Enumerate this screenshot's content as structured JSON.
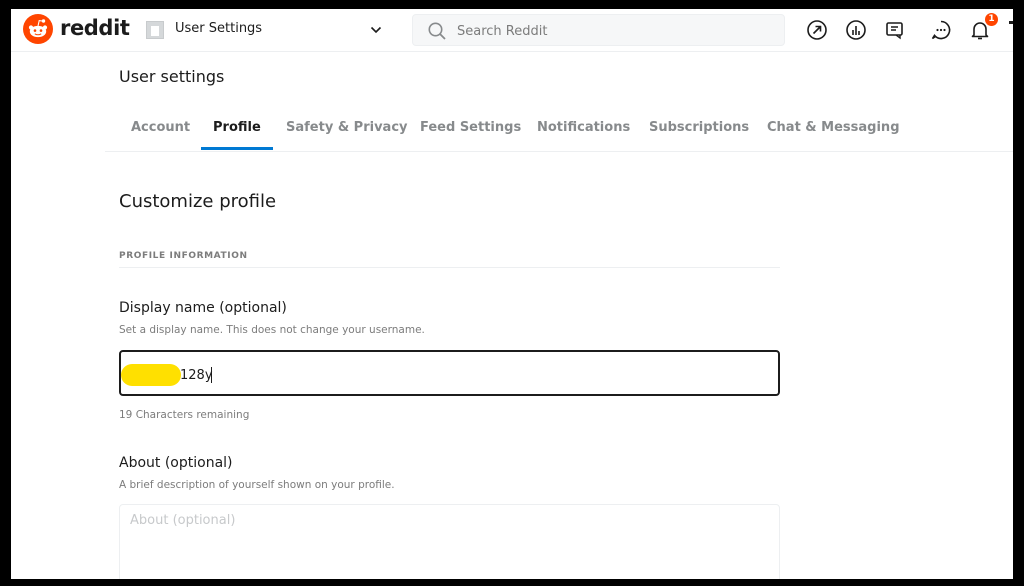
{
  "header": {
    "brand": "reddit",
    "community_label": "User Settings",
    "search_placeholder": "Search Reddit",
    "notification_count": "1",
    "colors": {
      "brand": "#ff4500",
      "accent": "#0079d3"
    }
  },
  "settings": {
    "title": "User settings",
    "tabs": [
      {
        "label": "Account",
        "active": false
      },
      {
        "label": "Profile",
        "active": true
      },
      {
        "label": "Safety & Privacy",
        "active": false
      },
      {
        "label": "Feed Settings",
        "active": false
      },
      {
        "label": "Notifications",
        "active": false
      },
      {
        "label": "Subscriptions",
        "active": false
      },
      {
        "label": "Chat & Messaging",
        "active": false
      }
    ]
  },
  "profile": {
    "section_title": "Customize profile",
    "subheading": "PROFILE INFORMATION",
    "display_name": {
      "label": "Display name (optional)",
      "help": "Set a display name. This does not change your username.",
      "value": "128y",
      "remaining": "19 Characters remaining"
    },
    "about": {
      "label": "About (optional)",
      "help": "A brief description of yourself shown on your profile.",
      "placeholder": "About (optional)"
    }
  },
  "icons": {
    "popular": "trending-arrow-icon",
    "communities": "stats-icon",
    "coins": "chat-feed-icon",
    "chat": "chat-bubble-icon",
    "notifications": "bell-icon"
  }
}
